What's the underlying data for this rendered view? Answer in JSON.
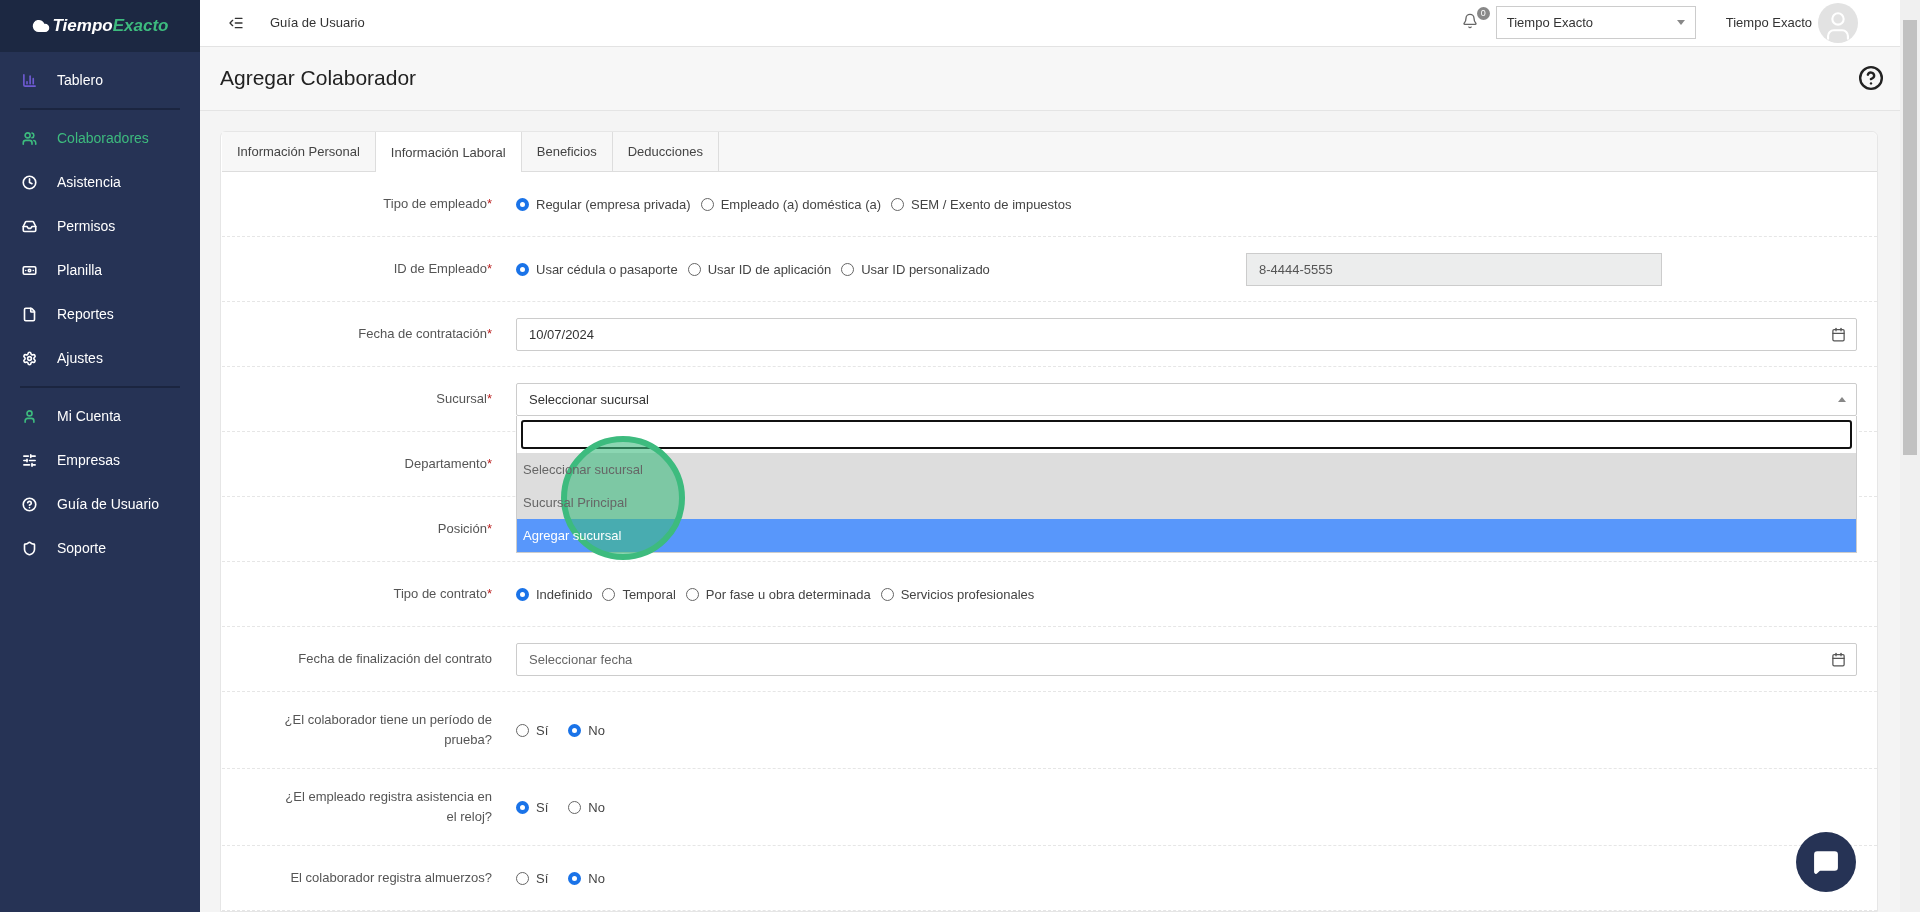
{
  "sidebar": {
    "logo": {
      "part_1": "Tiempo",
      "part_2": "Exacto"
    },
    "sections": [
      [
        {
          "label": "Tablero",
          "selected": false,
          "color": "#6f5bd3"
        }
      ],
      [
        {
          "label": "Colaboradores",
          "selected": true,
          "color": "#3dbb7e"
        },
        {
          "label": "Asistencia",
          "selected": false,
          "color": "#ffffff"
        },
        {
          "label": "Permisos",
          "selected": false,
          "color": "#ffffff"
        },
        {
          "label": "Planilla",
          "selected": false,
          "color": "#ffffff"
        },
        {
          "label": "Reportes",
          "selected": false,
          "color": "#ffffff"
        },
        {
          "label": "Ajustes",
          "selected": false,
          "color": "#ffffff"
        }
      ],
      [
        {
          "label": "Mi Cuenta",
          "selected": false,
          "color": "#3dbb7e"
        },
        {
          "label": "Empresas",
          "selected": false,
          "color": "#ffffff"
        },
        {
          "label": "Guía de Usuario",
          "selected": false,
          "color": "#ffffff"
        },
        {
          "label": "Soporte",
          "selected": false,
          "color": "#ffffff"
        }
      ]
    ]
  },
  "header": {
    "breadcrumb": "Guía de Usuario",
    "notification_count": "0",
    "company_select": "Tiempo Exacto",
    "user_name": "Tiempo Exacto"
  },
  "page_title": "Agregar Colaborador",
  "tabs": [
    {
      "label": "Información Personal",
      "selected": false
    },
    {
      "label": "Información Laboral",
      "selected": true
    },
    {
      "label": "Beneficios",
      "selected": false
    },
    {
      "label": "Deducciones",
      "selected": false
    }
  ],
  "form": [
    {
      "kind": "radio",
      "label": "Tipo de empleado",
      "required_mark": "*",
      "options": [
        {
          "label": "Regular (empresa privada)",
          "selected": true
        },
        {
          "label": "Empleado (a) doméstica (a)",
          "selected": false
        },
        {
          "label": "SEM / Exento de impuestos",
          "selected": false
        }
      ]
    },
    {
      "kind": "radio",
      "label": "ID de Empleado",
      "required_mark": "*",
      "options": [
        {
          "label": "Usar cédula o pasaporte",
          "selected": true
        },
        {
          "label": "Usar ID de aplicación",
          "selected": false
        },
        {
          "label": "Usar ID personalizado",
          "selected": false
        }
      ],
      "input": {
        "value": "8-4444-5555",
        "disabled": true
      }
    },
    {
      "kind": "date",
      "label": "Fecha de contratación",
      "required_mark": "*",
      "value": "10/07/2024"
    },
    {
      "kind": "select",
      "label": "Sucursal",
      "required_mark": "*",
      "value": "Seleccionar sucursal",
      "expanded": true,
      "dropdown": {
        "options": [
          {
            "label": "Seleccionar sucursal",
            "selected": false
          },
          {
            "label": "Sucursal Principal",
            "selected": false
          },
          {
            "label": "Agregar sucursal",
            "selected": true
          }
        ]
      }
    },
    {
      "kind": "covered",
      "label": "Departamento",
      "required_mark": "*"
    },
    {
      "kind": "covered",
      "label": "Posición",
      "required_mark": "*"
    },
    {
      "kind": "radio",
      "label": "Tipo de contrato",
      "required_mark": "*",
      "options": [
        {
          "label": "Indefinido",
          "selected": true
        },
        {
          "label": "Temporal",
          "selected": false
        },
        {
          "label": "Por fase u obra determinada",
          "selected": false
        },
        {
          "label": "Servicios profesionales",
          "selected": false
        }
      ]
    },
    {
      "kind": "date",
      "label": "Fecha de finalización del contrato",
      "placeholder": "Seleccionar fecha"
    },
    {
      "kind": "radio",
      "label": "¿El colaborador tiene un período de prueba?",
      "options": [
        {
          "label": "Sí",
          "selected": false
        },
        {
          "label": "No",
          "selected": true
        }
      ]
    },
    {
      "kind": "radio",
      "label": "¿El empleado registra asistencia en el reloj?",
      "options": [
        {
          "label": "Sí",
          "selected": true
        },
        {
          "label": "No",
          "selected": false
        }
      ]
    },
    {
      "kind": "radio",
      "label": "El colaborador registra almuerzos?",
      "options": [
        {
          "label": "Sí",
          "selected": false
        },
        {
          "label": "No",
          "selected": true
        }
      ]
    }
  ]
}
